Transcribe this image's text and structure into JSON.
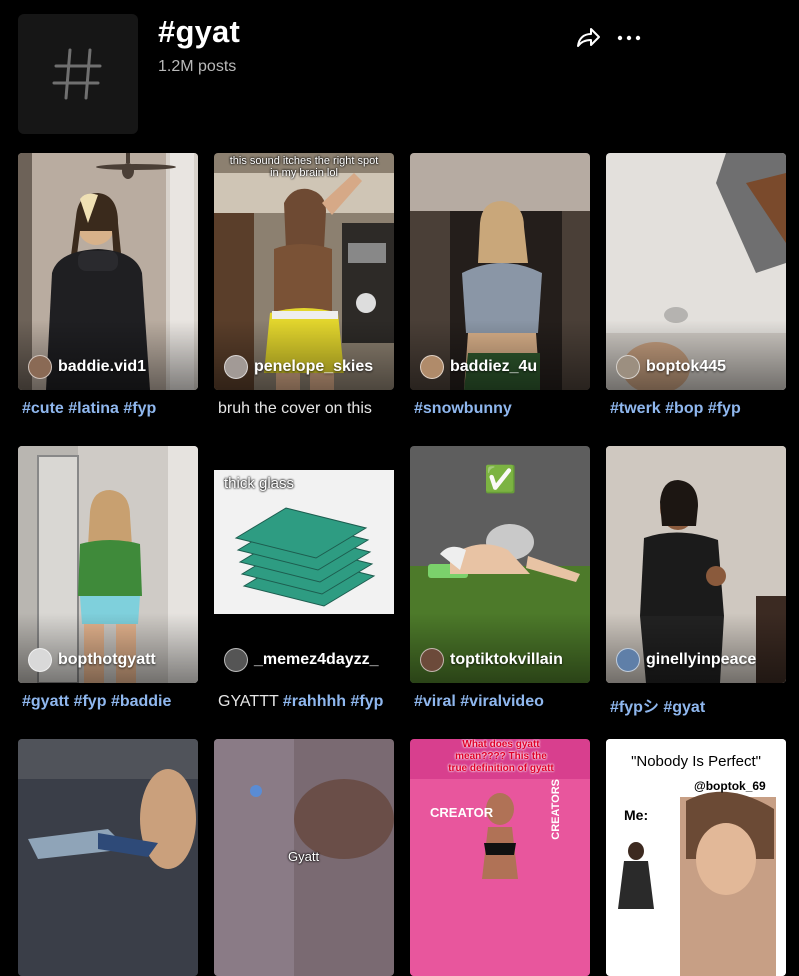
{
  "header": {
    "title": "#gyat",
    "posts": "1.2M posts",
    "share_icon": "share-arrow-icon",
    "more_icon": "more-dots-icon"
  },
  "videos": [
    {
      "user": "baddie.vid1",
      "caption": [
        {
          "t": "#cute",
          "tag": true
        },
        {
          "t": " ",
          "tag": false
        },
        {
          "t": "#latina",
          "tag": true
        },
        {
          "t": " ",
          "tag": false
        },
        {
          "t": "#fyp",
          "tag": true
        }
      ],
      "overlay": ""
    },
    {
      "user": "penelope_skies",
      "caption": [
        {
          "t": "bruh the cover on this",
          "tag": false
        }
      ],
      "overlay": "this sound itches the right spot in my brain lol"
    },
    {
      "user": "baddiez_4u",
      "caption": [
        {
          "t": "#snowbunny",
          "tag": true
        }
      ],
      "overlay": ""
    },
    {
      "user": "boptok445",
      "caption": [
        {
          "t": "#twerk",
          "tag": true
        },
        {
          "t": " ",
          "tag": false
        },
        {
          "t": "#bop",
          "tag": true
        },
        {
          "t": " ",
          "tag": false
        },
        {
          "t": "#fyp",
          "tag": true
        }
      ],
      "overlay": ""
    },
    {
      "user": "bopthotgyatt",
      "caption": [
        {
          "t": "#gyatt",
          "tag": true
        },
        {
          "t": " ",
          "tag": false
        },
        {
          "t": "#fyp",
          "tag": true
        },
        {
          "t": " ",
          "tag": false
        },
        {
          "t": "#baddie",
          "tag": true
        }
      ],
      "overlay": ""
    },
    {
      "user": "_memez4dayzz_",
      "caption": [
        {
          "t": "GYATTT ",
          "tag": false
        },
        {
          "t": "#rahhhh",
          "tag": true
        },
        {
          "t": " ",
          "tag": false
        },
        {
          "t": "#fyp",
          "tag": true
        }
      ],
      "overlay": "thick glass"
    },
    {
      "user": "toptiktokvillain",
      "caption": [
        {
          "t": "#viral",
          "tag": true
        },
        {
          "t": " ",
          "tag": false
        },
        {
          "t": "#viralvideo",
          "tag": true
        }
      ],
      "overlay": ""
    },
    {
      "user": "ginellyinpeace",
      "caption": [
        {
          "t": "#fypシ",
          "tag": true
        },
        {
          "t": " ",
          "tag": false
        },
        {
          "t": "#gyat",
          "tag": true
        }
      ],
      "overlay": ""
    },
    {
      "user": "",
      "caption": [],
      "overlay": ""
    },
    {
      "user": "",
      "caption": [],
      "overlay": "Gyatt"
    },
    {
      "user": "",
      "caption": [],
      "overlay": "What does gyatt mean???? This the true definition of gyatt"
    },
    {
      "user": "",
      "caption": [],
      "overlay": "\"Nobody Is Perfect\""
    }
  ],
  "extra_text": {
    "nobody_handle": "@boptok_69",
    "nobody_me": "Me:",
    "creators_sign": "CREATOR",
    "creators_sign2": "CREATORS",
    "check_mark": "✅"
  },
  "colors": {
    "background": "#000000",
    "hashtag": "#8fb7ee"
  }
}
